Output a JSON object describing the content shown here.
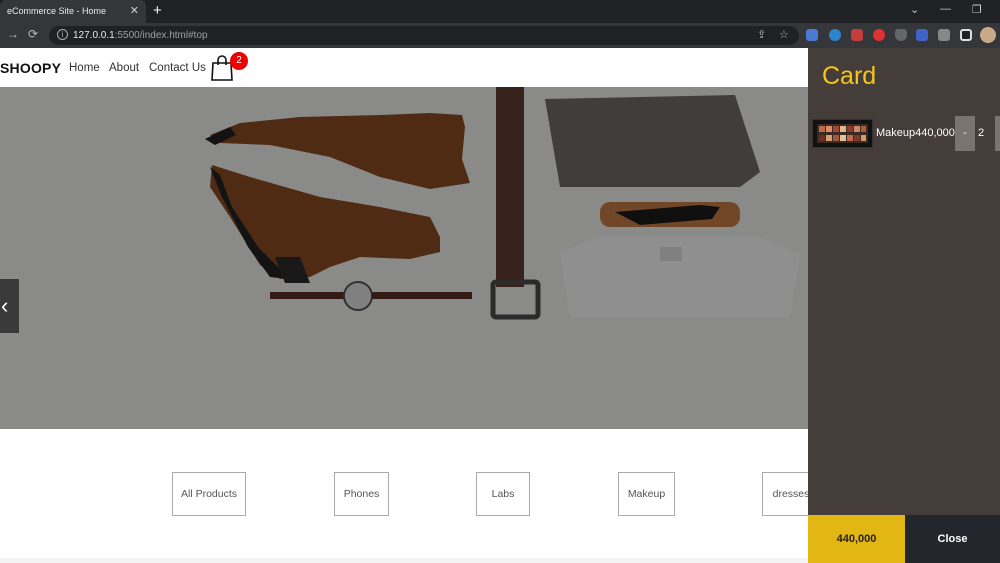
{
  "browser": {
    "tab_title": "eCommerce Site - Home",
    "tab_close": "✕",
    "new_tab": "+",
    "url_host": "127.0.0.1",
    "url_path": ":5500/index.html#top"
  },
  "header": {
    "brand": "SHOOPY",
    "nav": [
      "Home",
      "About",
      "Contact Us"
    ],
    "cart_count": "2"
  },
  "hero": {
    "prev_label": "‹"
  },
  "filters": [
    "All Products",
    "Phones",
    "Labs",
    "Makeup",
    "dresses"
  ],
  "cart": {
    "title": "Card",
    "items": [
      {
        "name": "Makeup",
        "price": "440,000",
        "minus": "-",
        "qty": "2"
      }
    ],
    "total": "440,000",
    "close_label": "Close"
  },
  "colors": {
    "accent": "#f5c518",
    "badge": "#ee0000",
    "panel": "#443d3a"
  }
}
